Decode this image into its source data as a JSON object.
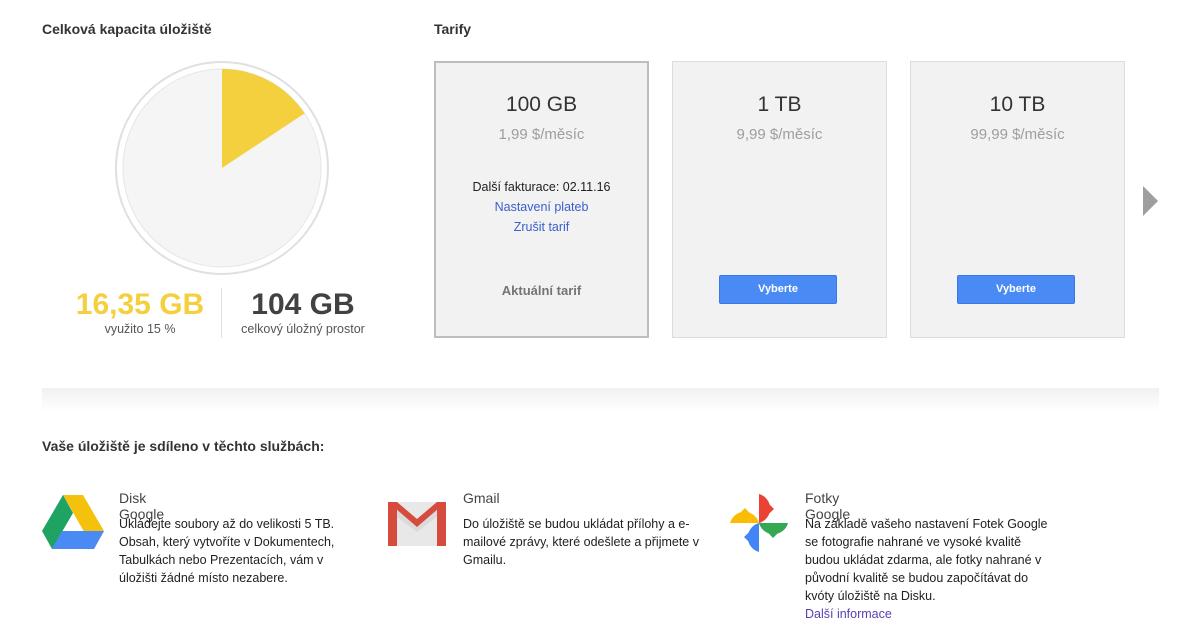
{
  "storage": {
    "title": "Celková kapacita úložiště",
    "used_value": "16,35 GB",
    "used_label": "využito 15 %",
    "used_fraction": 0.157,
    "total_value": "104 GB",
    "total_label": "celkový úložný prostor",
    "used_color": "#f4d03f",
    "free_color": "#f5f5f5"
  },
  "plans": {
    "title": "Tarify",
    "items": [
      {
        "size": "100 GB",
        "price": "1,99 $/měsíc",
        "billing": "Další fakturace: 02.11.16",
        "payment_link": "Nastavení plateb",
        "cancel_link": "Zrušit tarif",
        "current_label": "Aktuální tarif"
      },
      {
        "size": "1 TB",
        "price": "9,99 $/měsíc",
        "button": "Vyberte"
      },
      {
        "size": "10 TB",
        "price": "99,99 $/měsíc",
        "button": "Vyberte"
      }
    ],
    "next_icon": "chevron-right-icon"
  },
  "shared": {
    "title": "Vaše úložiště je sdíleno v těchto službách:",
    "services": [
      {
        "name": "Disk Google",
        "icon": "google-drive-icon",
        "description": "Ukládejte soubory až do velikosti 5 TB. Obsah, který vytvoříte v Dokumentech, Tabulkách nebo Prezentacích, vám v úložišti žádné místo nezabere."
      },
      {
        "name": "Gmail",
        "icon": "gmail-icon",
        "description": "Do úložiště se budou ukládat přílohy a e-mailové zprávy, které odešlete a přijmete v Gmailu."
      },
      {
        "name": "Fotky Google",
        "icon": "google-photos-icon",
        "description": "Na základě vašeho nastavení Fotek Google se fotografie nahrané ve vysoké kvalitě budou ukládat zdarma, ale fotky nahrané v původní kvalitě se budou započítávat do kvóty úložiště na Disku.",
        "more_link": "Další informace"
      }
    ]
  }
}
